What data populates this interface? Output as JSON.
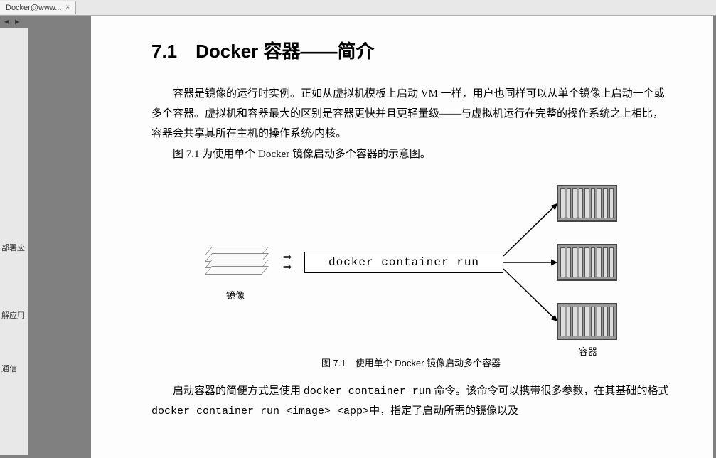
{
  "tab": {
    "title": "Docker@www...",
    "close": "×"
  },
  "nav": {
    "left": "◄",
    "right": "►"
  },
  "sidebar": {
    "items": [
      {
        "label": "部署应"
      },
      {
        "label": "解应用"
      },
      {
        "label": "通信"
      }
    ]
  },
  "content": {
    "heading": "7.1　Docker 容器——简介",
    "p1": "容器是镜像的运行时实例。正如从虚拟机模板上启动 VM 一样，用户也同样可以从单个镜像上启动一个或多个容器。虚拟机和容器最大的区别是容器更快并且更轻量级——与虚拟机运行在完整的操作系统之上相比，容器会共享其所在主机的操作系统/内核。",
    "p2": "图 7.1 为使用单个 Docker 镜像启动多个容器的示意图。",
    "p3_prefix": "启动容器的简便方式是使用 ",
    "p3_code1": "docker container run",
    "p3_mid": " 命令。该命令可以携带很多参数，在其基础的格式 ",
    "p3_code2": "docker container run <image> <app>",
    "p3_suffix": "中，指定了启动所需的镜像以及"
  },
  "figure": {
    "image_label": "镜像",
    "command": "docker container run",
    "arrow_in": "⇒",
    "container_label": "容器",
    "caption": "图 7.1　使用单个 Docker 镜像启动多个容器"
  }
}
